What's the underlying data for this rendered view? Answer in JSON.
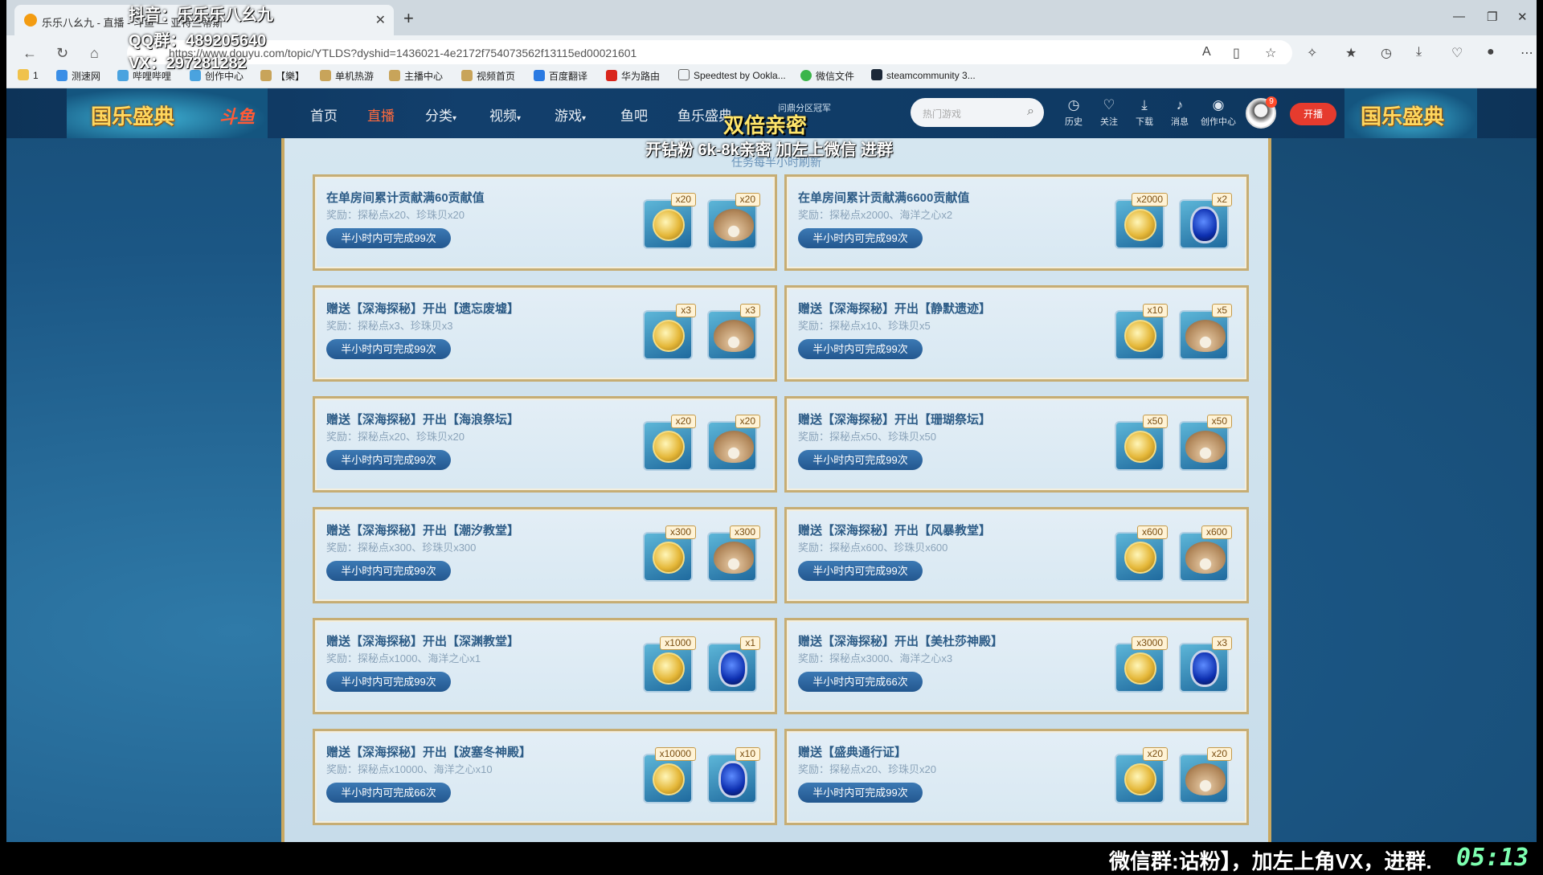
{
  "browser": {
    "tab_title": "乐乐八幺九 - 直播 - 斗鱼 — 亚特兰蒂斯",
    "new_tab": "+",
    "url": "https://www.douyu.com/topic/YTLDS?dyshid=1436021-4e2172f754073562f13115ed00021601",
    "bookmarks": [
      "1",
      "测速网",
      "哔哩哔哩",
      "创作中心",
      "【樂】",
      "单机热游",
      "主播中心",
      "视频首页",
      "百度翻译",
      "华为路由",
      "Speedtest by Ookla...",
      "微信文件",
      "steamcommunity 3..."
    ]
  },
  "site": {
    "banner_left": "国乐盛典",
    "banner_right": "国乐盛典",
    "logo": "斗鱼",
    "menu": [
      "首页",
      "直播",
      "分类",
      "视频",
      "游戏",
      "鱼吧",
      "鱼乐盛典"
    ],
    "active_menu": "直播",
    "search_placeholder": "热门游戏",
    "icons": [
      {
        "label": "历史",
        "icon": "clock-icon"
      },
      {
        "label": "关注",
        "icon": "heart-icon"
      },
      {
        "label": "下载",
        "icon": "download-icon"
      },
      {
        "label": "消息",
        "icon": "bell-icon"
      },
      {
        "label": "创作中心",
        "icon": "bulb-icon"
      }
    ],
    "avatar_badge": "9",
    "live_button": "开播",
    "small_label": "问鼎分区冠军"
  },
  "panel": {
    "refresh_note": "任务每半小时刷新",
    "cards": [
      {
        "title": "在单房间累计贡献满60贡献值",
        "reward": "奖励：探秘点x20、珍珠贝x20",
        "button": "半小时内可完成99次",
        "items": [
          {
            "kind": "coin",
            "qty": "x20"
          },
          {
            "kind": "pearl",
            "qty": "x20"
          }
        ]
      },
      {
        "title": "在单房间累计贡献满6600贡献值",
        "reward": "奖励：探秘点x2000、海洋之心x2",
        "button": "半小时内可完成99次",
        "items": [
          {
            "kind": "coin",
            "qty": "x2000"
          },
          {
            "kind": "gem",
            "qty": "x2"
          }
        ]
      },
      {
        "title": "赠送【深海探秘】开出【遗忘废墟】",
        "reward": "奖励：探秘点x3、珍珠贝x3",
        "button": "半小时内可完成99次",
        "items": [
          {
            "kind": "coin",
            "qty": "x3"
          },
          {
            "kind": "pearl",
            "qty": "x3"
          }
        ]
      },
      {
        "title": "赠送【深海探秘】开出【静默遗迹】",
        "reward": "奖励：探秘点x10、珍珠贝x5",
        "button": "半小时内可完成99次",
        "items": [
          {
            "kind": "coin",
            "qty": "x10"
          },
          {
            "kind": "pearl",
            "qty": "x5"
          }
        ]
      },
      {
        "title": "赠送【深海探秘】开出【海浪祭坛】",
        "reward": "奖励：探秘点x20、珍珠贝x20",
        "button": "半小时内可完成99次",
        "items": [
          {
            "kind": "coin",
            "qty": "x20"
          },
          {
            "kind": "pearl",
            "qty": "x20"
          }
        ]
      },
      {
        "title": "赠送【深海探秘】开出【珊瑚祭坛】",
        "reward": "奖励：探秘点x50、珍珠贝x50",
        "button": "半小时内可完成99次",
        "items": [
          {
            "kind": "coin",
            "qty": "x50"
          },
          {
            "kind": "pearl",
            "qty": "x50"
          }
        ]
      },
      {
        "title": "赠送【深海探秘】开出【潮汐教堂】",
        "reward": "奖励：探秘点x300、珍珠贝x300",
        "button": "半小时内可完成99次",
        "items": [
          {
            "kind": "coin",
            "qty": "x300"
          },
          {
            "kind": "pearl",
            "qty": "x300"
          }
        ]
      },
      {
        "title": "赠送【深海探秘】开出【风暴教堂】",
        "reward": "奖励：探秘点x600、珍珠贝x600",
        "button": "半小时内可完成99次",
        "items": [
          {
            "kind": "coin",
            "qty": "x600"
          },
          {
            "kind": "pearl",
            "qty": "x600"
          }
        ]
      },
      {
        "title": "赠送【深海探秘】开出【深渊教堂】",
        "reward": "奖励：探秘点x1000、海洋之心x1",
        "button": "半小时内可完成99次",
        "items": [
          {
            "kind": "coin",
            "qty": "x1000"
          },
          {
            "kind": "gem",
            "qty": "x1"
          }
        ]
      },
      {
        "title": "赠送【深海探秘】开出【美杜莎神殿】",
        "reward": "奖励：探秘点x3000、海洋之心x3",
        "button": "半小时内可完成66次",
        "items": [
          {
            "kind": "coin",
            "qty": "x3000"
          },
          {
            "kind": "gem",
            "qty": "x3"
          }
        ]
      },
      {
        "title": "赠送【深海探秘】开出【波塞冬神殿】",
        "reward": "奖励：探秘点x10000、海洋之心x10",
        "button": "半小时内可完成66次",
        "items": [
          {
            "kind": "coin",
            "qty": "x10000"
          },
          {
            "kind": "gem",
            "qty": "x10"
          }
        ]
      },
      {
        "title": "赠送【盛典通行证】",
        "reward": "奖励：探秘点x20、珍珠贝x20",
        "button": "半小时内可完成99次",
        "items": [
          {
            "kind": "coin",
            "qty": "x20"
          },
          {
            "kind": "pearl",
            "qty": "x20"
          }
        ]
      }
    ]
  },
  "overlay": {
    "douyin": "抖音：乐乐乐八幺九",
    "qq": "QQ群：489205640",
    "vx": "VX：297281282",
    "double": "双倍亲密",
    "recruit": "开钻粉 6k-8k亲密 加左上微信 进群",
    "bottom": "微信群:诂粉】，加左上角VX，进群.",
    "clock": "05:13"
  }
}
